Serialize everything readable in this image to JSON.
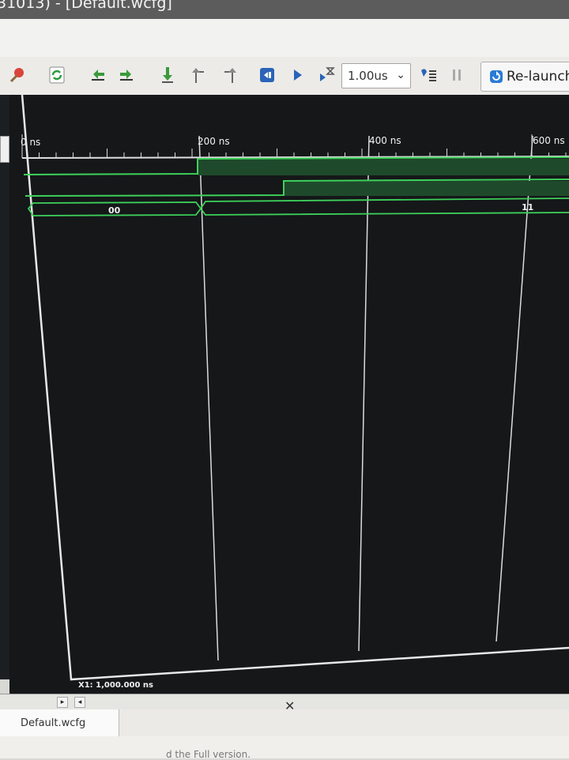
{
  "window": {
    "title": "31013) - [Default.wcfg]"
  },
  "toolbar": {
    "icons": [
      "pin-icon",
      "refresh-icon",
      "go-to-previous-icon",
      "go-to-next-icon",
      "add-marker-icon",
      "previous-transition-icon",
      "next-transition-icon",
      "restart-icon",
      "run-all-icon",
      "run-for-time-icon"
    ],
    "run_time": "1.00us",
    "break_icon": "break-icon",
    "pause_icon": "pause-icon",
    "relaunch_label": "Re-launch",
    "relaunch_icon": "relaunch-icon"
  },
  "waveform": {
    "ruler_labels": [
      "0 ns",
      "200 ns",
      "400 ns",
      "600 ns"
    ],
    "ruler_ticks_ns": [
      0,
      200,
      400,
      600
    ],
    "bus_values": [
      "00",
      "11"
    ],
    "cursor_readout": "X1: 1,000.000 ns",
    "signal_color": "#3dd15a",
    "background_color": "#151719"
  },
  "tabs": [
    {
      "label": "Default.wcfg"
    }
  ],
  "footer": {
    "text": "d the Full version."
  },
  "colors": {
    "toolbar_bg": "#ecebe8",
    "wave_green": "#3dd15a",
    "relaunch_icon": "#2a7bd6"
  }
}
